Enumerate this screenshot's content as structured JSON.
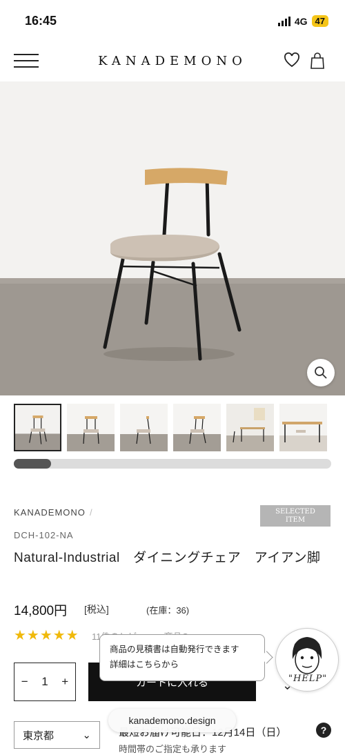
{
  "status": {
    "time": "16:45",
    "network": "4G",
    "battery": "47"
  },
  "header": {
    "logo": "KANADEMONO",
    "menu_icon": "hamburger-icon",
    "favorite_icon": "heart-icon",
    "cart_icon": "shopping-bag-icon"
  },
  "gallery": {
    "zoom_icon": "magnifier-icon",
    "thumbnail_count": 6,
    "scroll_position": 0.1
  },
  "product": {
    "brand": "KANADEMONO",
    "brand_separator": "/",
    "badge_line1": "SELECTED",
    "badge_line2": "ITEM",
    "sku": "DCH-102-NA",
    "title": "Natural-Industrial　ダイニングチェア　アイアン脚",
    "price": "14,800円",
    "tax": "[税込]",
    "stock": "(在庫：36)",
    "rating_stars": "★★★★★",
    "rating": 5,
    "review_text": "11件のレビュー・商品Q"
  },
  "popup": {
    "line1": "商品の見積書は自動発行できます",
    "line2": "詳細はこちらから"
  },
  "help": {
    "label": "\"HELP\"",
    "chevron": "⌄"
  },
  "cart": {
    "minus": "−",
    "quantity": "1",
    "plus": "+",
    "add_label": "カートに入れる"
  },
  "delivery": {
    "region": "東京都",
    "region_chevron": "⌄",
    "date": "最短お届け可能日：12月14日（日）",
    "sub": "時間帯のご指定も承ります",
    "help_mark": "?"
  },
  "browser": {
    "url": "kanademono.design"
  }
}
